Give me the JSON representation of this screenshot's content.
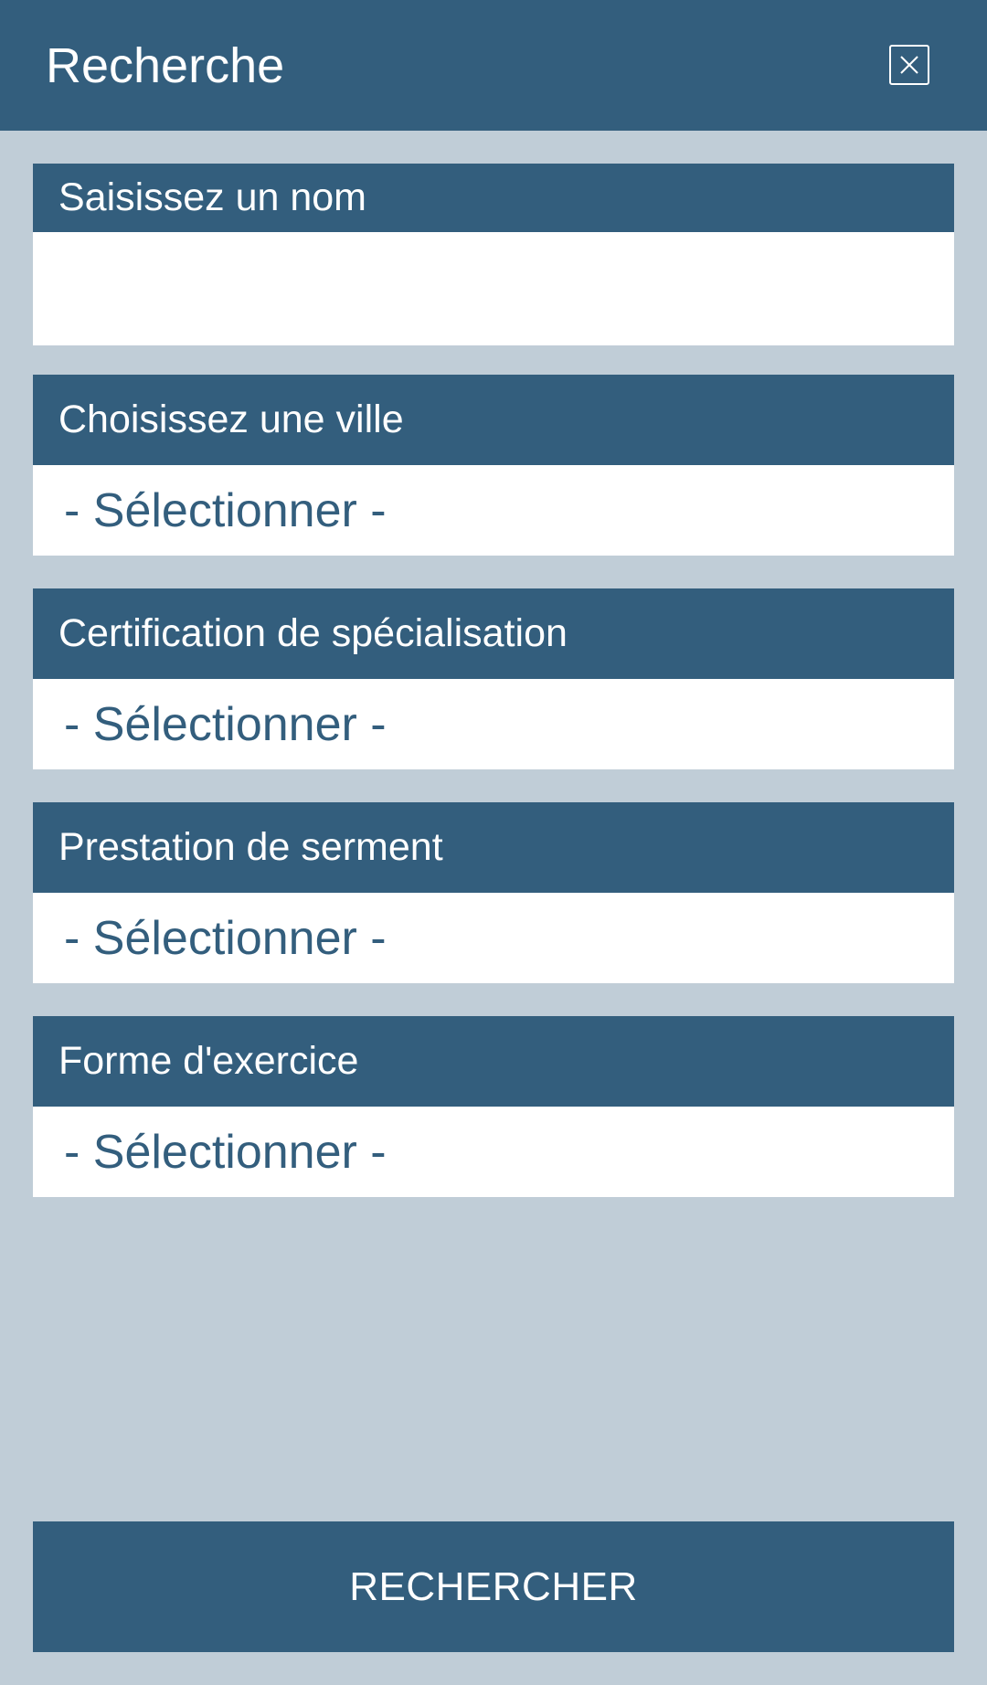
{
  "header": {
    "title": "Recherche"
  },
  "fields": {
    "name": {
      "label": "Saisissez un nom",
      "value": ""
    },
    "city": {
      "label": "Choisissez une ville",
      "selected": "- Sélectionner -"
    },
    "certification": {
      "label": "Certification de spécialisation",
      "selected": "- Sélectionner -"
    },
    "oath": {
      "label": "Prestation de serment",
      "selected": "- Sélectionner -"
    },
    "practice": {
      "label": "Forme d'exercice",
      "selected": "- Sélectionner -"
    }
  },
  "actions": {
    "search_label": "RECHERCHER"
  },
  "colors": {
    "primary": "#335e7d",
    "background": "#c0cdd7",
    "surface": "#ffffff"
  }
}
